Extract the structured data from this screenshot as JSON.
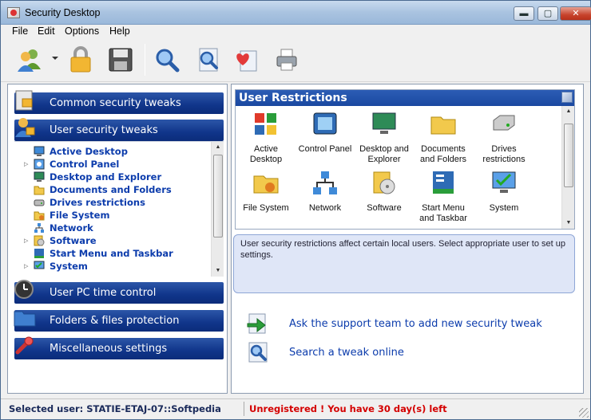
{
  "window": {
    "title": "Security Desktop",
    "buttons": {
      "minimize": "▬",
      "maximize": "▢",
      "close": "✕"
    }
  },
  "menu": {
    "items": [
      "File",
      "Edit",
      "Options",
      "Help"
    ]
  },
  "toolbar": {
    "icons": [
      "users-icon",
      "lock-icon",
      "save-icon",
      "search-icon",
      "search-page-icon",
      "heart-page-icon",
      "printer-icon"
    ]
  },
  "sidebar": {
    "sections": {
      "common": "Common security tweaks",
      "user": "User security tweaks",
      "time": "User PC time control",
      "folders": "Folders & files protection",
      "misc": "Miscellaneous settings"
    },
    "tree": [
      {
        "label": "Active Desktop",
        "expandable": false
      },
      {
        "label": "Control Panel",
        "expandable": true
      },
      {
        "label": "Desktop and Explorer",
        "expandable": false
      },
      {
        "label": "Documents and Folders",
        "expandable": false
      },
      {
        "label": "Drives restrictions",
        "expandable": false
      },
      {
        "label": "File System",
        "expandable": false
      },
      {
        "label": "Network",
        "expandable": false
      },
      {
        "label": "Software",
        "expandable": true
      },
      {
        "label": "Start Menu and Taskbar",
        "expandable": false
      },
      {
        "label": "System",
        "expandable": true
      }
    ]
  },
  "restrictions": {
    "title": "User Restrictions",
    "tiles": [
      [
        "Active",
        "Desktop"
      ],
      [
        "Control Panel",
        ""
      ],
      [
        "Desktop and",
        "Explorer"
      ],
      [
        "Documents",
        "and Folders"
      ],
      [
        "Drives",
        "restrictions"
      ],
      [
        "File System",
        ""
      ],
      [
        "Network",
        ""
      ],
      [
        "Software",
        ""
      ],
      [
        "Start Menu",
        "and Taskbar"
      ],
      [
        "System",
        ""
      ]
    ]
  },
  "info": {
    "text": "User security restrictions affect certain local users. Select appropriate user to set up settings."
  },
  "actions": {
    "support": "Ask the support team to add new security tweak",
    "search": "Search a tweak online"
  },
  "status": {
    "user": "Selected user: STATIE-ETAJ-07::Softpedia",
    "registration": "Unregistered ! You have 30 day(s) left"
  },
  "colors": {
    "section_header": "#10358a",
    "link_blue": "#0c3cac",
    "warning_red": "#d40000",
    "info_bg": "#dfe6f7"
  }
}
